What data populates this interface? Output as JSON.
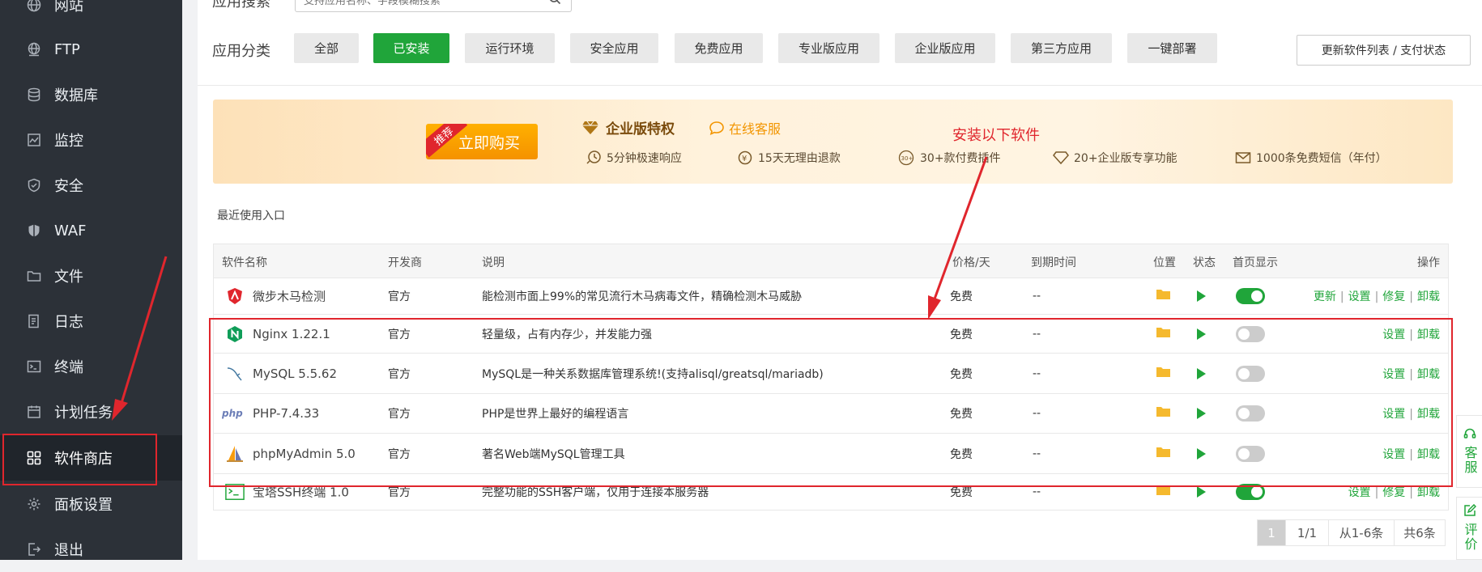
{
  "sidebar": {
    "items": [
      {
        "label": "网站",
        "icon": "globe-icon"
      },
      {
        "label": "FTP",
        "icon": "ftp-globe-icon"
      },
      {
        "label": "数据库",
        "icon": "database-icon"
      },
      {
        "label": "监控",
        "icon": "monitor-icon"
      },
      {
        "label": "安全",
        "icon": "shield-icon"
      },
      {
        "label": "WAF",
        "icon": "waf-shield-icon"
      },
      {
        "label": "文件",
        "icon": "folder-icon"
      },
      {
        "label": "日志",
        "icon": "log-icon"
      },
      {
        "label": "终端",
        "icon": "terminal-icon"
      },
      {
        "label": "计划任务",
        "icon": "calendar-icon"
      },
      {
        "label": "软件商店",
        "icon": "grid-icon",
        "active": true
      },
      {
        "label": "面板设置",
        "icon": "gear-icon"
      },
      {
        "label": "退出",
        "icon": "logout-icon"
      }
    ]
  },
  "search": {
    "label": "应用搜索",
    "placeholder": "支持应用名称、字段模糊搜索"
  },
  "categories": {
    "label": "应用分类",
    "items": [
      "全部",
      "已安装",
      "运行环境",
      "安全应用",
      "免费应用",
      "专业版应用",
      "企业版应用",
      "第三方应用",
      "一键部署"
    ],
    "active_index": 1
  },
  "update_button": "更新软件列表 / 支付状态",
  "banner": {
    "tag": "推荐",
    "buy_label": "立即购买",
    "title": "企业版特权",
    "cs_label": "在线客服",
    "features": [
      "5分钟极速响应",
      "15天无理由退款",
      "30+款付费插件",
      "20+企业版专享功能",
      "1000条免费短信（年付）"
    ]
  },
  "annotation": "安装以下软件",
  "recent_label": "最近使用入口",
  "table": {
    "headers": {
      "name": "软件名称",
      "dev": "开发商",
      "desc": "说明",
      "price": "价格/天",
      "expire": "到期时间",
      "location": "位置",
      "status": "状态",
      "home": "首页显示",
      "ops": "操作"
    },
    "rows": [
      {
        "name": "微步木马检测",
        "dev": "官方",
        "desc": "能检测市面上99%的常见流行木马病毒文件，精确检测木马威胁",
        "price": "免费",
        "expire": "--",
        "home_on": true,
        "ops": [
          "更新",
          "设置",
          "修复",
          "卸载"
        ],
        "logo": "weibu-logo-icon"
      },
      {
        "name": "Nginx 1.22.1",
        "dev": "官方",
        "desc": "轻量级，占有内存少，并发能力强",
        "price": "免费",
        "expire": "--",
        "home_on": false,
        "ops": [
          "设置",
          "卸载"
        ],
        "logo": "nginx-logo-icon"
      },
      {
        "name": "MySQL 5.5.62",
        "dev": "官方",
        "desc": "MySQL是一种关系数据库管理系统!(支持alisql/greatsql/mariadb)",
        "price": "免费",
        "expire": "--",
        "home_on": false,
        "ops": [
          "设置",
          "卸载"
        ],
        "logo": "mysql-logo-icon"
      },
      {
        "name": "PHP-7.4.33",
        "dev": "官方",
        "desc": "PHP是世界上最好的编程语言",
        "price": "免费",
        "expire": "--",
        "home_on": false,
        "ops": [
          "设置",
          "卸载"
        ],
        "logo": "php-logo-icon"
      },
      {
        "name": "phpMyAdmin 5.0",
        "dev": "官方",
        "desc": "著名Web端MySQL管理工具",
        "price": "免费",
        "expire": "--",
        "home_on": false,
        "ops": [
          "设置",
          "卸载"
        ],
        "logo": "phpmyadmin-logo-icon"
      },
      {
        "name": "宝塔SSH终端 1.0",
        "dev": "官方",
        "desc": "完整功能的SSH客户端，仅用于连接本服务器",
        "price": "免费",
        "expire": "--",
        "home_on": true,
        "ops": [
          "设置",
          "修复",
          "卸载"
        ],
        "logo": "ssh-terminal-logo-icon"
      }
    ]
  },
  "pagination": {
    "current": "1",
    "pages": "1/1",
    "range": "从1-6条",
    "total": "共6条"
  },
  "side_tabs": {
    "service": "客服",
    "review": "评价"
  },
  "colors": {
    "accent": "#20a53a",
    "sidebar": "#2c3138",
    "annotation": "#e0262d",
    "banner_button": "#f59200"
  }
}
